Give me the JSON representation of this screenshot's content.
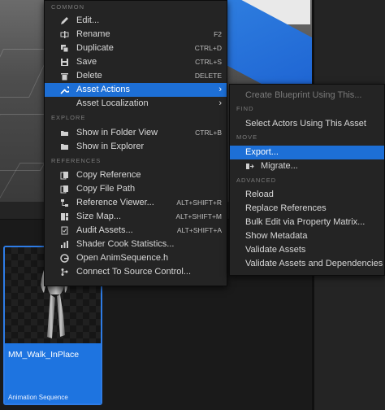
{
  "main_menu": {
    "sections": {
      "common": "COMMON",
      "explore": "EXPLORE",
      "references": "REFERENCES"
    },
    "items": [
      {
        "label": "Edit...",
        "shortcut": "",
        "icon": "pencil-icon"
      },
      {
        "label": "Rename",
        "shortcut": "F2",
        "icon": "rename-icon"
      },
      {
        "label": "Duplicate",
        "shortcut": "CTRL+D",
        "icon": "duplicate-icon"
      },
      {
        "label": "Save",
        "shortcut": "CTRL+S",
        "icon": "save-icon"
      },
      {
        "label": "Delete",
        "shortcut": "DELETE",
        "icon": "trash-icon"
      },
      {
        "label": "Asset Actions",
        "shortcut": "",
        "icon": "wrench-icon",
        "submenu": true,
        "highlighted": true
      },
      {
        "label": "Asset Localization",
        "shortcut": "",
        "icon": "localization-icon",
        "submenu": true
      },
      {
        "label": "Show in Folder View",
        "shortcut": "CTRL+B",
        "icon": "folder-search-icon"
      },
      {
        "label": "Show in Explorer",
        "shortcut": "",
        "icon": "folder-icon"
      },
      {
        "label": "Copy Reference",
        "shortcut": "",
        "icon": "copy-icon"
      },
      {
        "label": "Copy File Path",
        "shortcut": "",
        "icon": "copy-path-icon"
      },
      {
        "label": "Reference Viewer...",
        "shortcut": "ALT+SHIFT+R",
        "icon": "reference-viewer-icon"
      },
      {
        "label": "Size Map...",
        "shortcut": "ALT+SHIFT+M",
        "icon": "size-map-icon"
      },
      {
        "label": "Audit Assets...",
        "shortcut": "ALT+SHIFT+A",
        "icon": "audit-icon"
      },
      {
        "label": "Shader Cook Statistics...",
        "shortcut": "",
        "icon": "statistics-icon"
      },
      {
        "label": "Open AnimSequence.h",
        "shortcut": "",
        "icon": "cpp-file-icon"
      },
      {
        "label": "Connect To Source Control...",
        "shortcut": "",
        "icon": "source-control-icon"
      }
    ]
  },
  "sub_menu": {
    "sections": {
      "find": "FIND",
      "move": "MOVE",
      "advanced": "ADVANCED"
    },
    "items": [
      {
        "label": "Create Blueprint Using This...",
        "disabled": true
      },
      {
        "label": "Select Actors Using This Asset"
      },
      {
        "label": "Export...",
        "highlighted": true
      },
      {
        "label": "Migrate..."
      },
      {
        "label": "Reload"
      },
      {
        "label": "Replace References"
      },
      {
        "label": "Bulk Edit via Property Matrix..."
      },
      {
        "label": "Show Metadata"
      },
      {
        "label": "Validate Assets"
      },
      {
        "label": "Validate Assets and Dependencies"
      }
    ]
  },
  "asset": {
    "name": "MM_Walk_InPlace",
    "type": "Animation Sequence"
  },
  "colors": {
    "highlight": "#1d6fd6",
    "menu_bg": "#242424",
    "asset_blue": "#1e74e0"
  }
}
